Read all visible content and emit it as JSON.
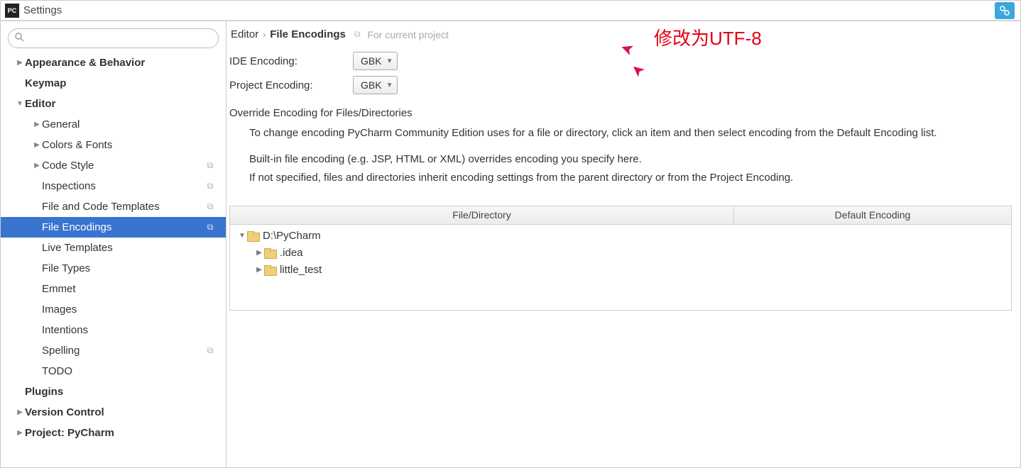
{
  "window": {
    "title": "Settings"
  },
  "search": {
    "placeholder": ""
  },
  "sidebar": {
    "items": [
      {
        "label": "Appearance & Behavior",
        "level": 0,
        "bold": true,
        "expand": "collapsed"
      },
      {
        "label": "Keymap",
        "level": 0,
        "bold": true
      },
      {
        "label": "Editor",
        "level": 0,
        "bold": true,
        "expand": "expanded"
      },
      {
        "label": "General",
        "level": 1,
        "expand": "collapsed"
      },
      {
        "label": "Colors & Fonts",
        "level": 1,
        "expand": "collapsed"
      },
      {
        "label": "Code Style",
        "level": 1,
        "expand": "collapsed",
        "badge": true
      },
      {
        "label": "Inspections",
        "level": 1,
        "badge": true
      },
      {
        "label": "File and Code Templates",
        "level": 1,
        "badge": true
      },
      {
        "label": "File Encodings",
        "level": 1,
        "badge": true,
        "selected": true
      },
      {
        "label": "Live Templates",
        "level": 1
      },
      {
        "label": "File Types",
        "level": 1
      },
      {
        "label": "Emmet",
        "level": 1
      },
      {
        "label": "Images",
        "level": 1
      },
      {
        "label": "Intentions",
        "level": 1
      },
      {
        "label": "Spelling",
        "level": 1,
        "badge": true
      },
      {
        "label": "TODO",
        "level": 1
      },
      {
        "label": "Plugins",
        "level": 0,
        "bold": true
      },
      {
        "label": "Version Control",
        "level": 0,
        "bold": true,
        "expand": "collapsed"
      },
      {
        "label": "Project: PyCharm",
        "level": 0,
        "bold": true,
        "expand": "collapsed"
      }
    ]
  },
  "breadcrumb": {
    "parent": "Editor",
    "current": "File Encodings",
    "hint": "For current project"
  },
  "annotation": "修改为UTF-8",
  "form": {
    "ide_label": "IDE Encoding:",
    "ide_value": "GBK",
    "proj_label": "Project Encoding:",
    "proj_value": "GBK"
  },
  "override": {
    "title": "Override Encoding for Files/Directories",
    "help1": "To change encoding PyCharm Community Edition uses for a file or directory, click an item and then select encoding from the Default Encoding list.",
    "help2": "Built-in file encoding (e.g. JSP, HTML or XML) overrides encoding you specify here.",
    "help3": "If not specified, files and directories inherit encoding settings from the parent directory or from the Project Encoding."
  },
  "table": {
    "col_file": "File/Directory",
    "col_enc": "Default Encoding",
    "rows": [
      {
        "label": "D:\\PyCharm",
        "level": 0,
        "expand": "expanded"
      },
      {
        "label": ".idea",
        "level": 1,
        "expand": "collapsed"
      },
      {
        "label": "little_test",
        "level": 1,
        "expand": "collapsed"
      }
    ]
  }
}
